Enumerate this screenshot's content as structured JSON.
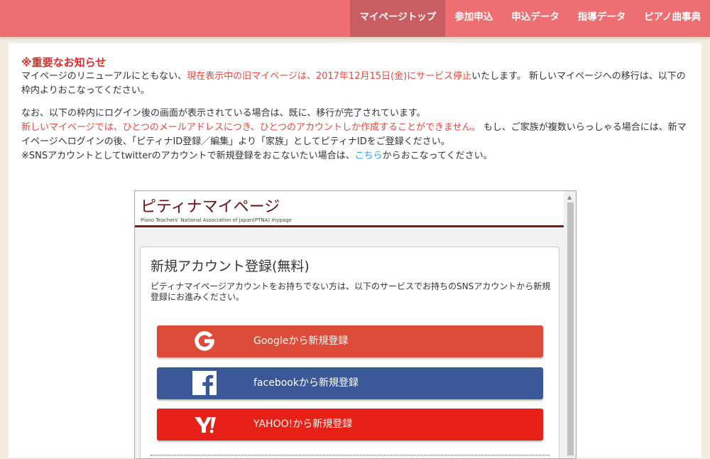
{
  "nav": {
    "items": [
      {
        "label": "マイページトップ",
        "active": true
      },
      {
        "label": "参加申込"
      },
      {
        "label": "申込データ"
      },
      {
        "label": "指導データ"
      },
      {
        "label": "ピアノ曲事典"
      }
    ]
  },
  "notice": {
    "title": "※重要なお知らせ",
    "p1_a": "マイページのリニューアルにともない、",
    "p1_red": "現在表示中の旧マイページは、2017年12月15日(金)にサービス停止",
    "p1_b": "いたします。 新しいマイページへの移行は、以下の枠内よりおこなってください。",
    "p2_a": "なお、以下の枠内にログイン後の画面が表示されている場合は、既に、移行が完了されています。",
    "p2_red": "新しいマイページでは、ひとつのメールアドレスにつき、ひとつのアカウントしか作成することができません。",
    "p2_b": " もし、ご家族が複数いらっしゃる場合には、新マイページへログインの後、「ピティナID登録／編集」より「家族」としてピティナIDをご登録ください。",
    "p3_a": "※SNSアカウントとしてtwitterのアカウントで新規登録をおこないたい場合は、",
    "p3_link": "こちら",
    "p3_b": "からおこなってください。"
  },
  "frame": {
    "title": "ピティナマイページ",
    "subtitle": "Piano Teachers' National Association of Japan(PTNA) mypage",
    "card_title": "新規アカウント登録(無料)",
    "card_desc": "ピティナマイページアカウントをお持ちでない方は、以下のサービスでお持ちのSNSアカウントから新規登録にお進みください。",
    "buttons": {
      "google": "Googleから新規登録",
      "facebook": "facebookから新規登録",
      "yahoo": "YAHOO!から新規登録"
    },
    "icons": {
      "google": "google-g-icon",
      "facebook": "facebook-f-icon",
      "yahoo": "yahoo-y-icon"
    }
  },
  "colors": {
    "nav_bg": "#ee6f72",
    "nav_active": "#c95e62",
    "notice_red": "#e8483f",
    "link_blue": "#2a9ce8",
    "google": "#dd4b39",
    "facebook": "#3b5998",
    "yahoo": "#e82118",
    "frame_title": "#6a1010"
  }
}
